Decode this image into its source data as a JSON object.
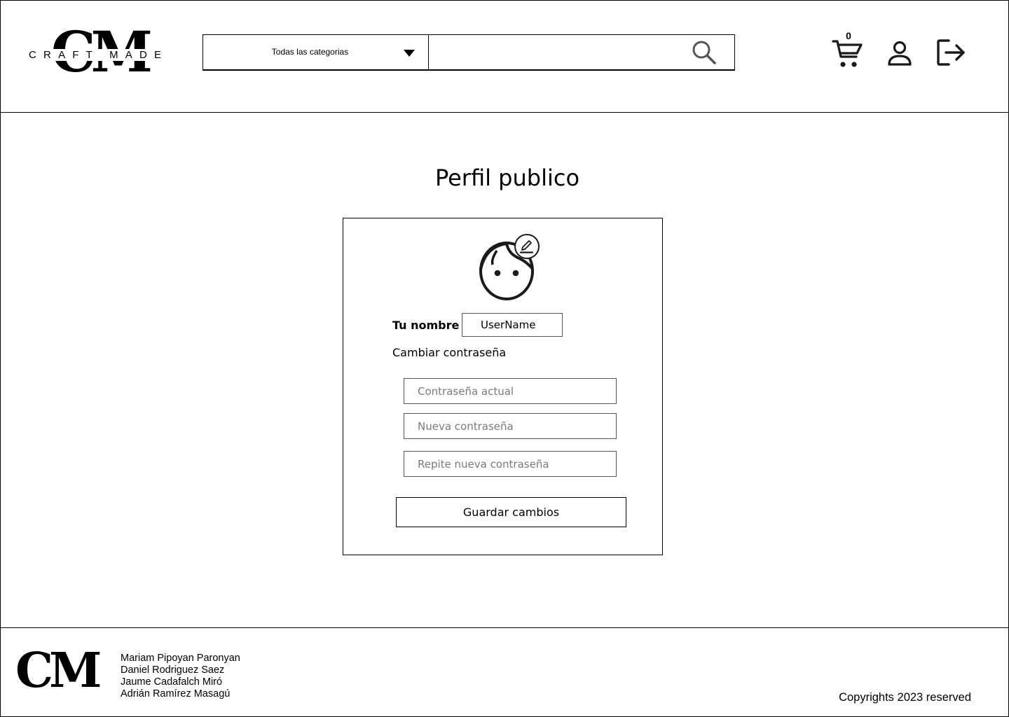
{
  "header": {
    "logo": {
      "monogram": "CM",
      "wordmark": "CRAFT MADE"
    },
    "search": {
      "category_label": "Todas las categorias",
      "placeholder": "",
      "value": ""
    },
    "cart": {
      "count": "0"
    },
    "icons": {
      "cart": "cart-icon",
      "user": "user-icon",
      "logout": "logout-icon",
      "search": "search-icon"
    }
  },
  "main": {
    "title": "Perfil publico",
    "profile": {
      "name_label": "Tu nombre",
      "name_value": "UserName",
      "change_password_label": "Cambiar contraseña",
      "current_password_placeholder": "Contraseña actual",
      "new_password_placeholder": "Nueva contraseña",
      "repeat_password_placeholder": "Repite nueva contraseña",
      "save_label": "Guardar cambios"
    }
  },
  "footer": {
    "monogram": "CM",
    "authors": [
      "Mariam Pipoyan Paronyan",
      "Daniel Rodriguez Saez",
      "Jaume Cadafalch Miró",
      "Adrián Ramírez Masagú"
    ],
    "copyright": "Copyrights 2023 reserved"
  }
}
